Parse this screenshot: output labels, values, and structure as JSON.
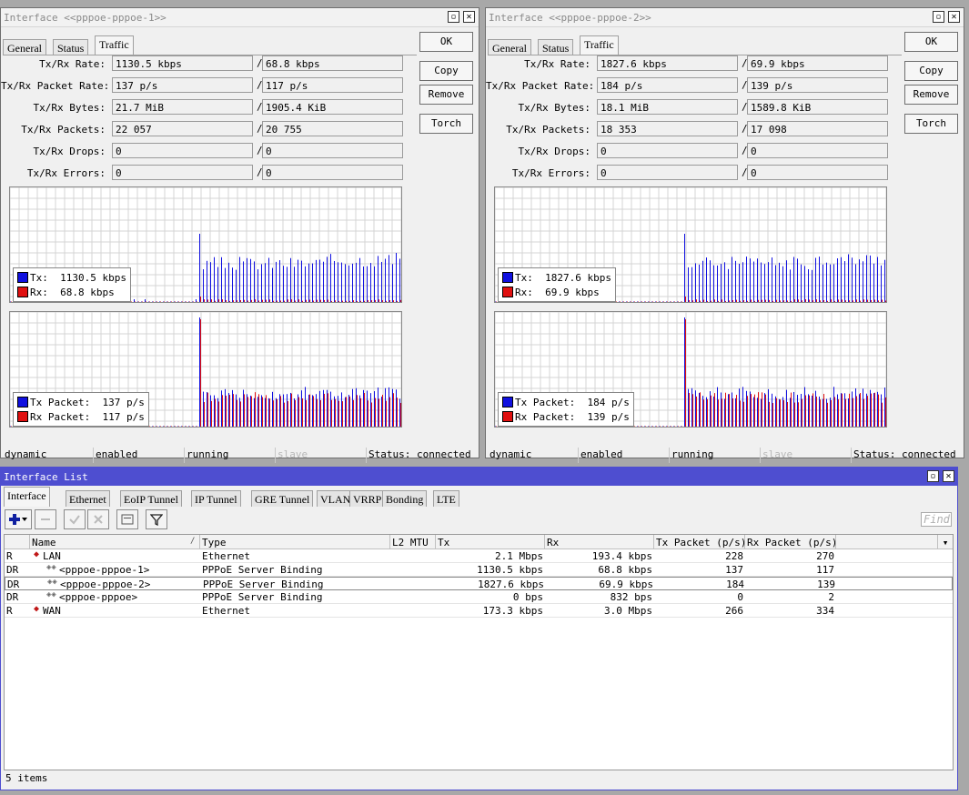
{
  "win1": {
    "title": "Interface <<pppoe-pppoe-1>>",
    "tabs": [
      "General",
      "Status",
      "Traffic"
    ],
    "buttons": [
      "OK",
      "Copy",
      "Remove",
      "Torch"
    ],
    "rows": [
      {
        "label": "Tx/Rx Rate:",
        "tx": "1130.5 kbps",
        "rx": "68.8 kbps"
      },
      {
        "label": "Tx/Rx Packet Rate:",
        "tx": "137 p/s",
        "rx": "117 p/s"
      },
      {
        "label": "Tx/Rx Bytes:",
        "tx": "21.7 MiB",
        "rx": "1905.4 KiB"
      },
      {
        "label": "Tx/Rx Packets:",
        "tx": "22 057",
        "rx": "20 755"
      },
      {
        "label": "Tx/Rx Drops:",
        "tx": "0",
        "rx": "0"
      },
      {
        "label": "Tx/Rx Errors:",
        "tx": "0",
        "rx": "0"
      }
    ],
    "legend_rate": {
      "tx": "Tx:  1130.5 kbps",
      "rx": "Rx:  68.8 kbps"
    },
    "legend_pkt": {
      "tx": "Tx Packet:  137 p/s",
      "rx": "Rx Packet:  117 p/s"
    },
    "status": [
      "dynamic",
      "enabled",
      "running",
      "slave",
      "Status: connected"
    ]
  },
  "win2": {
    "title": "Interface <<pppoe-pppoe-2>>",
    "tabs": [
      "General",
      "Status",
      "Traffic"
    ],
    "buttons": [
      "OK",
      "Copy",
      "Remove",
      "Torch"
    ],
    "rows": [
      {
        "label": "Tx/Rx Rate:",
        "tx": "1827.6 kbps",
        "rx": "69.9 kbps"
      },
      {
        "label": "Tx/Rx Packet Rate:",
        "tx": "184 p/s",
        "rx": "139 p/s"
      },
      {
        "label": "Tx/Rx Bytes:",
        "tx": "18.1 MiB",
        "rx": "1589.8 KiB"
      },
      {
        "label": "Tx/Rx Packets:",
        "tx": "18 353",
        "rx": "17 098"
      },
      {
        "label": "Tx/Rx Drops:",
        "tx": "0",
        "rx": "0"
      },
      {
        "label": "Tx/Rx Errors:",
        "tx": "0",
        "rx": "0"
      }
    ],
    "legend_rate": {
      "tx": "Tx:  1827.6 kbps",
      "rx": "Rx:  69.9 kbps"
    },
    "legend_pkt": {
      "tx": "Tx Packet:  184 p/s",
      "rx": "Rx Packet:  139 p/s"
    },
    "status": [
      "dynamic",
      "enabled",
      "running",
      "slave",
      "Status: connected"
    ]
  },
  "colors": {
    "tx": "#1010e0",
    "rx": "#e01010",
    "title_active": "#4e4ed0"
  },
  "list": {
    "title": "Interface List",
    "tabs": [
      "Interface",
      "Ethernet",
      "EoIP Tunnel",
      "IP Tunnel",
      "GRE Tunnel",
      "VLAN",
      "VRRP",
      "Bonding",
      "LTE"
    ],
    "find_placeholder": "Find",
    "columns": [
      "",
      "Name",
      "Type",
      "L2 MTU",
      "Tx",
      "Rx",
      "Tx Packet (p/s)",
      "Rx Packet (p/s)"
    ],
    "rows": [
      {
        "flags": "R",
        "name": "LAN",
        "type": "Ethernet",
        "mtu": "",
        "tx": "2.1 Mbps",
        "rx": "193.4 kbps",
        "txp": "228",
        "rxp": "270"
      },
      {
        "flags": "DR",
        "name": "<pppoe-pppoe-1>",
        "type": "PPPoE Server Binding",
        "mtu": "",
        "tx": "1130.5 kbps",
        "rx": "68.8 kbps",
        "txp": "137",
        "rxp": "117"
      },
      {
        "flags": "DR",
        "name": "<pppoe-pppoe-2>",
        "type": "PPPoE Server Binding",
        "mtu": "",
        "tx": "1827.6 kbps",
        "rx": "69.9 kbps",
        "txp": "184",
        "rxp": "139"
      },
      {
        "flags": "DR",
        "name": "<pppoe-pppoe>",
        "type": "PPPoE Server Binding",
        "mtu": "",
        "tx": "0 bps",
        "rx": "832 bps",
        "txp": "0",
        "rxp": "2"
      },
      {
        "flags": "R",
        "name": "WAN",
        "type": "Ethernet",
        "mtu": "",
        "tx": "173.3 kbps",
        "rx": "3.0 Mbps",
        "txp": "266",
        "rxp": "334"
      }
    ],
    "footer": "5 items"
  }
}
